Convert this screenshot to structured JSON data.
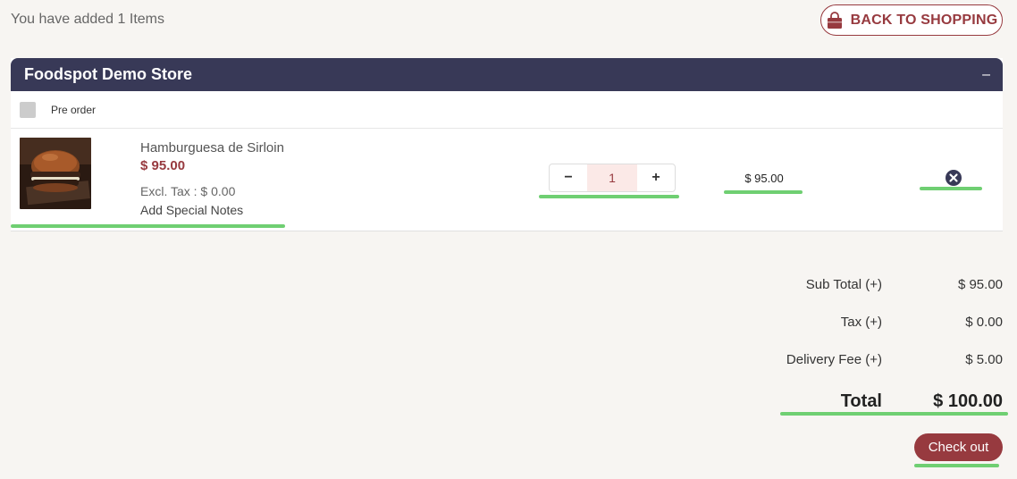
{
  "header": {
    "items_text": "You have added 1 Items",
    "back_button": "BACK TO SHOPPING",
    "back_icon": "shopping-bag-icon"
  },
  "store": {
    "name": "Foodspot Demo Store",
    "collapse_symbol": "–",
    "pre_order_label": "Pre order",
    "pre_order_checked": false
  },
  "cart_item": {
    "name": "Hamburguesa de Sirloin",
    "price": "$ 95.00",
    "tax": "Excl. Tax : $  0.00",
    "notes_link": "Add Special Notes",
    "quantity": "1",
    "minus": "−",
    "plus": "+",
    "line_total": "$ 95.00",
    "remove_icon": "close-circle-icon"
  },
  "summary": {
    "subtotal_label": "Sub Total (+)",
    "subtotal_value": "$ 95.00",
    "tax_label": "Tax (+)",
    "tax_value": "$ 0.00",
    "delivery_label": "Delivery Fee (+)",
    "delivery_value": "$ 5.00",
    "total_label": "Total",
    "total_value": "$ 100.00"
  },
  "checkout_button": "Check out",
  "colors": {
    "brand": "#973a3f",
    "header_bar": "#383957",
    "highlight": "#6fcf72",
    "background": "#f7f5f2"
  }
}
